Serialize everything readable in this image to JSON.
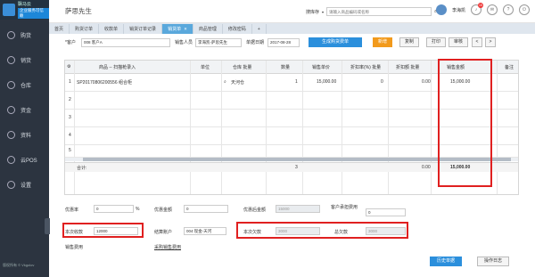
{
  "sidebar": {
    "logo_title": "飘马云",
    "logo_sub": "企业服务可信赖",
    "items": [
      {
        "label": "购货",
        "icon": "cart-icon"
      },
      {
        "label": "销货",
        "icon": "sales-icon"
      },
      {
        "label": "仓库",
        "icon": "warehouse-icon"
      },
      {
        "label": "资金",
        "icon": "money-icon"
      },
      {
        "label": "资料",
        "icon": "data-icon"
      },
      {
        "label": "云POS",
        "icon": "pos-icon"
      },
      {
        "label": "设置",
        "icon": "settings-icon"
      }
    ],
    "footer": "版权所有 © Vkgolov"
  },
  "header": {
    "user_name": "萨思先生",
    "search_label": "搜库存",
    "search_placeholder": "请输入商品编码或名称",
    "account": "李海凯",
    "badge_count": "15"
  },
  "tabs": [
    {
      "label": "首页"
    },
    {
      "label": "购货订单"
    },
    {
      "label": "收款单"
    },
    {
      "label": "销货订单记录"
    },
    {
      "label": "销货单",
      "active": true
    },
    {
      "label": "商品管理"
    },
    {
      "label": "修改密码"
    }
  ],
  "toolbar": {
    "customer_label": "*客户",
    "customer_value": "008 客户A",
    "salesperson_label": "销售人员",
    "salesperson_value": "李海凯-萨思先生",
    "date_label": "单据日期",
    "date_value": "2017-08-28",
    "generate_btn": "生成购货费单",
    "save_btn": "新增",
    "copy_btn": "复制",
    "print_btn": "打印",
    "audit_btn": "审核",
    "prev_btn": "<",
    "next_btn": ">"
  },
  "grid": {
    "headers": [
      "商品 -- 扫描枪录入",
      "单位",
      "仓库 批量",
      "数量",
      "销售单价",
      "折扣率(%) 批量",
      "折扣额 批量",
      "销售金额",
      "备注"
    ],
    "rows": [
      {
        "no": "1",
        "product": "SP20170806200556 组合柜",
        "warehouse": "天河仓",
        "qty": "1",
        "price": "15,000.00",
        "rate": "0",
        "disc": "0.00",
        "amount": "15,000.00"
      },
      {
        "no": "2"
      },
      {
        "no": "3"
      },
      {
        "no": "4"
      },
      {
        "no": "5"
      }
    ],
    "sum_label": "合计:",
    "sum_qty": "3",
    "sum_disc": "0.00",
    "sum_amount": "15,000.00"
  },
  "bottom": {
    "discount_rate_label": "优惠率",
    "discount_rate_value": "0",
    "percent": "%",
    "discount_amount_label": "优惠金额",
    "discount_amount_value": "0",
    "after_discount_label": "优惠后金额",
    "after_discount_value": "15000",
    "cust_fee_label": "客户承担费用",
    "cust_fee_value": "0",
    "received_label": "本次收款",
    "received_value": "12000",
    "account_label": "结算账户",
    "account_value": "004 现金-天河",
    "this_debt_label": "本次欠款",
    "this_debt_value": "3000",
    "total_debt_label": "总欠款",
    "total_debt_value": "3000",
    "sales_fee_label": "销售费用",
    "link_label": "采购销售费用",
    "history_btn": "历史单据",
    "log_btn": "操作日志"
  }
}
